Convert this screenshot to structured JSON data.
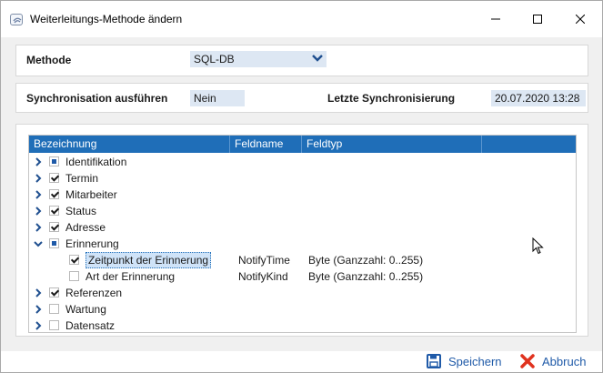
{
  "window": {
    "title": "Weiterleitungs-Methode ändern"
  },
  "methode": {
    "label": "Methode",
    "value": "SQL-DB"
  },
  "sync": {
    "run_label": "Synchronisation ausführen",
    "run_value": "Nein",
    "last_label": "Letzte Synchronisierung",
    "last_value": "20.07.2020 13:28"
  },
  "grid": {
    "columns": [
      "Bezeichnung",
      "Feldname",
      "Feldtyp",
      ""
    ],
    "rows": [
      {
        "label": "Identifikation",
        "state": "partial",
        "expander": "collapsed",
        "level": 0,
        "feldname": "",
        "feldtyp": ""
      },
      {
        "label": "Termin",
        "state": "checked",
        "expander": "collapsed",
        "level": 0,
        "feldname": "",
        "feldtyp": ""
      },
      {
        "label": "Mitarbeiter",
        "state": "checked",
        "expander": "collapsed",
        "level": 0,
        "feldname": "",
        "feldtyp": ""
      },
      {
        "label": "Status",
        "state": "checked",
        "expander": "collapsed",
        "level": 0,
        "feldname": "",
        "feldtyp": ""
      },
      {
        "label": "Adresse",
        "state": "checked",
        "expander": "collapsed",
        "level": 0,
        "feldname": "",
        "feldtyp": ""
      },
      {
        "label": "Erinnerung",
        "state": "partial",
        "expander": "expanded",
        "level": 0,
        "feldname": "",
        "feldtyp": ""
      },
      {
        "label": "Zeitpunkt der Erinnerung",
        "state": "checked",
        "expander": "none",
        "level": 1,
        "focused": true,
        "feldname": "NotifyTime",
        "feldtyp": "Byte (Ganzzahl: 0..255)"
      },
      {
        "label": "Art der Erinnerung",
        "state": "unchecked",
        "expander": "none",
        "level": 1,
        "feldname": "NotifyKind",
        "feldtyp": "Byte (Ganzzahl: 0..255)"
      },
      {
        "label": "Referenzen",
        "state": "checked",
        "expander": "collapsed",
        "level": 0,
        "feldname": "",
        "feldtyp": ""
      },
      {
        "label": "Wartung",
        "state": "unchecked",
        "expander": "collapsed",
        "level": 0,
        "feldname": "",
        "feldtyp": ""
      },
      {
        "label": "Datensatz",
        "state": "unchecked",
        "expander": "collapsed",
        "level": 0,
        "feldname": "",
        "feldtyp": ""
      }
    ]
  },
  "footer": {
    "save_label": "Speichern",
    "cancel_label": "Abbruch"
  },
  "colors": {
    "accent": "#1f6eb8",
    "cancel_icon": "#e0321e",
    "field_bg": "#dde7f3"
  }
}
